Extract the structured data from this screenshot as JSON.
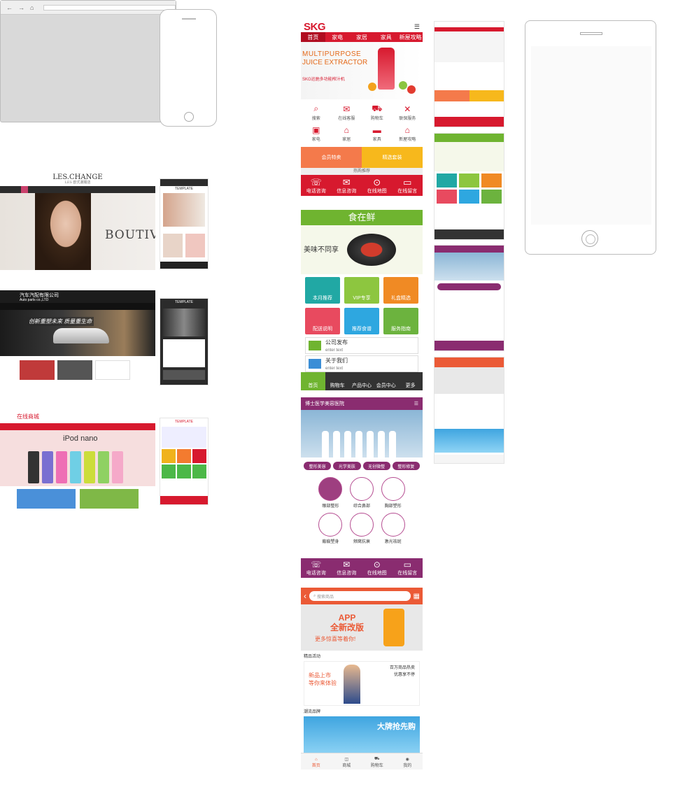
{
  "skg": {
    "logo": "SKG",
    "logo_sub": "家居\n.COM",
    "nav": [
      "首页",
      "家电",
      "家居",
      "家具",
      "新屋攻略"
    ],
    "banner_line1": "MULTIPURPOSE",
    "banner_line2": "JUICE EXTRACTOR",
    "banner_line3": "SKG迅驰多功能榨汁机",
    "grid": [
      {
        "icon": "search-icon",
        "label": "搜索"
      },
      {
        "icon": "chat-icon",
        "label": "在线客服"
      },
      {
        "icon": "cart-icon",
        "label": "购物车"
      },
      {
        "icon": "tools-icon",
        "label": "联保服务"
      },
      {
        "icon": "appliance-icon",
        "label": "家电"
      },
      {
        "icon": "home-icon",
        "label": "家居"
      },
      {
        "icon": "bed-icon",
        "label": "家具"
      },
      {
        "icon": "house-icon",
        "label": "新屋攻略"
      }
    ],
    "promo": [
      {
        "label": "会员特卖",
        "color": "#f47a4b"
      },
      {
        "label": "精选套装",
        "color": "#f7b81c"
      }
    ],
    "band": "热购推荐",
    "footer": [
      "电话咨询",
      "信息咨询",
      "在线地图",
      "在线留言"
    ]
  },
  "food": {
    "title": "食在鲜",
    "slogan": "美味不同享",
    "tiles": [
      {
        "label": "本月推荐",
        "color": "#21a8a4"
      },
      {
        "label": "VIP专享",
        "color": "#8dc63f"
      },
      {
        "label": "礼盒精选",
        "color": "#f08a24"
      },
      {
        "label": "配送说明",
        "color": "#e84a5f"
      },
      {
        "label": "推荐食谱",
        "color": "#2ea7e0"
      },
      {
        "label": "服务指南",
        "color": "#6cb33e"
      }
    ],
    "list": [
      {
        "label": "公司发布",
        "sub": "enter text"
      },
      {
        "label": "关于我们",
        "sub": "enter text"
      }
    ],
    "footer": [
      "首页",
      "购物车",
      "产品中心",
      "会员中心",
      "更多"
    ]
  },
  "clinic": {
    "title": "博士医学美容医院",
    "tabs": [
      "整形美容",
      "光学美肤",
      "无创微整",
      "整形修复"
    ],
    "items": [
      "眼部整形",
      "综合鼻部",
      "胸部塑形",
      "瘢痕塑身",
      "颊窝抗衰",
      "激光祛斑"
    ],
    "footer": [
      "电话咨询",
      "信息咨询",
      "在线地图",
      "在线留言"
    ]
  },
  "shop": {
    "search_placeholder": "搜索商品",
    "banner_a": "APP\n全新改版",
    "banner_b": "更多惊喜等着你!",
    "section1": "精品活动",
    "promo_left": "新品上市\n等你来体验",
    "promo_right": "百万商品热卖\n优惠享不停",
    "section2": "潮流品牌",
    "brand_title": "大牌抢先购",
    "footer": [
      "首页",
      "商城",
      "购物车",
      "我的"
    ]
  },
  "desktop": {
    "les_title": "LES.CHANGE",
    "les_sub": "LES 欧式潮服店",
    "les_hero": "BOUTIVU",
    "car_title": "汽车汽配有限公司",
    "car_sub": "Auto parts co.,LTD",
    "car_slogan": "创新重塑未来 质量重生命",
    "ipod_title": "在线商城",
    "ipod_hero": "iPod nano",
    "template": "TEMPLATE"
  }
}
